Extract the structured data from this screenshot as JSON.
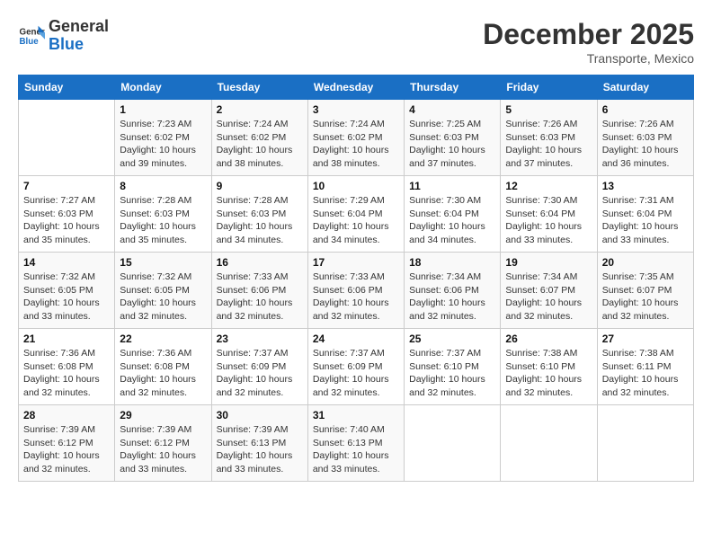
{
  "header": {
    "logo_general": "General",
    "logo_blue": "Blue",
    "month_title": "December 2025",
    "subtitle": "Transporte, Mexico"
  },
  "days_of_week": [
    "Sunday",
    "Monday",
    "Tuesday",
    "Wednesday",
    "Thursday",
    "Friday",
    "Saturday"
  ],
  "weeks": [
    [
      {
        "day": "",
        "info": ""
      },
      {
        "day": "1",
        "info": "Sunrise: 7:23 AM\nSunset: 6:02 PM\nDaylight: 10 hours\nand 39 minutes."
      },
      {
        "day": "2",
        "info": "Sunrise: 7:24 AM\nSunset: 6:02 PM\nDaylight: 10 hours\nand 38 minutes."
      },
      {
        "day": "3",
        "info": "Sunrise: 7:24 AM\nSunset: 6:02 PM\nDaylight: 10 hours\nand 38 minutes."
      },
      {
        "day": "4",
        "info": "Sunrise: 7:25 AM\nSunset: 6:03 PM\nDaylight: 10 hours\nand 37 minutes."
      },
      {
        "day": "5",
        "info": "Sunrise: 7:26 AM\nSunset: 6:03 PM\nDaylight: 10 hours\nand 37 minutes."
      },
      {
        "day": "6",
        "info": "Sunrise: 7:26 AM\nSunset: 6:03 PM\nDaylight: 10 hours\nand 36 minutes."
      }
    ],
    [
      {
        "day": "7",
        "info": "Sunrise: 7:27 AM\nSunset: 6:03 PM\nDaylight: 10 hours\nand 35 minutes."
      },
      {
        "day": "8",
        "info": "Sunrise: 7:28 AM\nSunset: 6:03 PM\nDaylight: 10 hours\nand 35 minutes."
      },
      {
        "day": "9",
        "info": "Sunrise: 7:28 AM\nSunset: 6:03 PM\nDaylight: 10 hours\nand 34 minutes."
      },
      {
        "day": "10",
        "info": "Sunrise: 7:29 AM\nSunset: 6:04 PM\nDaylight: 10 hours\nand 34 minutes."
      },
      {
        "day": "11",
        "info": "Sunrise: 7:30 AM\nSunset: 6:04 PM\nDaylight: 10 hours\nand 34 minutes."
      },
      {
        "day": "12",
        "info": "Sunrise: 7:30 AM\nSunset: 6:04 PM\nDaylight: 10 hours\nand 33 minutes."
      },
      {
        "day": "13",
        "info": "Sunrise: 7:31 AM\nSunset: 6:04 PM\nDaylight: 10 hours\nand 33 minutes."
      }
    ],
    [
      {
        "day": "14",
        "info": "Sunrise: 7:32 AM\nSunset: 6:05 PM\nDaylight: 10 hours\nand 33 minutes."
      },
      {
        "day": "15",
        "info": "Sunrise: 7:32 AM\nSunset: 6:05 PM\nDaylight: 10 hours\nand 32 minutes."
      },
      {
        "day": "16",
        "info": "Sunrise: 7:33 AM\nSunset: 6:06 PM\nDaylight: 10 hours\nand 32 minutes."
      },
      {
        "day": "17",
        "info": "Sunrise: 7:33 AM\nSunset: 6:06 PM\nDaylight: 10 hours\nand 32 minutes."
      },
      {
        "day": "18",
        "info": "Sunrise: 7:34 AM\nSunset: 6:06 PM\nDaylight: 10 hours\nand 32 minutes."
      },
      {
        "day": "19",
        "info": "Sunrise: 7:34 AM\nSunset: 6:07 PM\nDaylight: 10 hours\nand 32 minutes."
      },
      {
        "day": "20",
        "info": "Sunrise: 7:35 AM\nSunset: 6:07 PM\nDaylight: 10 hours\nand 32 minutes."
      }
    ],
    [
      {
        "day": "21",
        "info": "Sunrise: 7:36 AM\nSunset: 6:08 PM\nDaylight: 10 hours\nand 32 minutes."
      },
      {
        "day": "22",
        "info": "Sunrise: 7:36 AM\nSunset: 6:08 PM\nDaylight: 10 hours\nand 32 minutes."
      },
      {
        "day": "23",
        "info": "Sunrise: 7:37 AM\nSunset: 6:09 PM\nDaylight: 10 hours\nand 32 minutes."
      },
      {
        "day": "24",
        "info": "Sunrise: 7:37 AM\nSunset: 6:09 PM\nDaylight: 10 hours\nand 32 minutes."
      },
      {
        "day": "25",
        "info": "Sunrise: 7:37 AM\nSunset: 6:10 PM\nDaylight: 10 hours\nand 32 minutes."
      },
      {
        "day": "26",
        "info": "Sunrise: 7:38 AM\nSunset: 6:10 PM\nDaylight: 10 hours\nand 32 minutes."
      },
      {
        "day": "27",
        "info": "Sunrise: 7:38 AM\nSunset: 6:11 PM\nDaylight: 10 hours\nand 32 minutes."
      }
    ],
    [
      {
        "day": "28",
        "info": "Sunrise: 7:39 AM\nSunset: 6:12 PM\nDaylight: 10 hours\nand 32 minutes."
      },
      {
        "day": "29",
        "info": "Sunrise: 7:39 AM\nSunset: 6:12 PM\nDaylight: 10 hours\nand 33 minutes."
      },
      {
        "day": "30",
        "info": "Sunrise: 7:39 AM\nSunset: 6:13 PM\nDaylight: 10 hours\nand 33 minutes."
      },
      {
        "day": "31",
        "info": "Sunrise: 7:40 AM\nSunset: 6:13 PM\nDaylight: 10 hours\nand 33 minutes."
      },
      {
        "day": "",
        "info": ""
      },
      {
        "day": "",
        "info": ""
      },
      {
        "day": "",
        "info": ""
      }
    ]
  ]
}
